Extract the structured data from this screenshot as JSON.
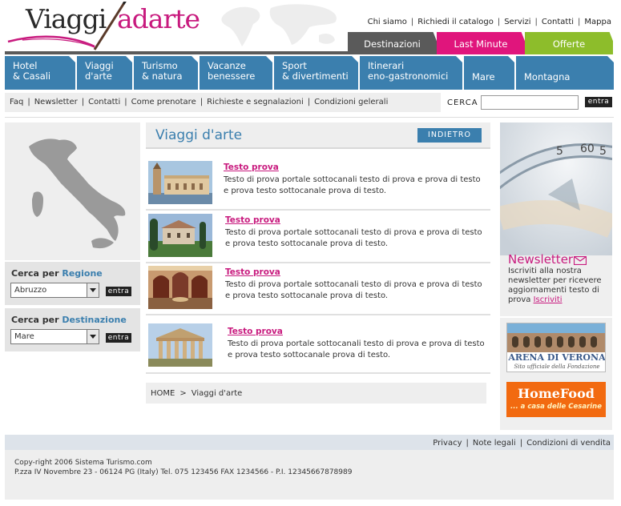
{
  "logo": {
    "part1": "Viaggi",
    "part2": "adarte"
  },
  "top_links": [
    "Chi siamo",
    "Richiedi il catalogo",
    "Servizi",
    "Contatti",
    "Mappa"
  ],
  "quick_tabs": [
    "Destinazioni",
    "Last Minute",
    "Offerte"
  ],
  "main_nav": [
    {
      "label": "Hotel\n& Casali"
    },
    {
      "label": "Viaggi\nd'arte"
    },
    {
      "label": "Turismo\n& natura"
    },
    {
      "label": "Vacanze\nbenessere"
    },
    {
      "label": "Sport\n& divertimenti"
    },
    {
      "label": "Itinerari\neno-gastronomici"
    },
    {
      "label": "Mare"
    },
    {
      "label": "Montagna"
    }
  ],
  "sub_links": [
    "Faq",
    "Newsletter",
    "Contatti",
    "Come prenotare",
    "Richieste e segnalazioni",
    "Condizioni gelerali"
  ],
  "search": {
    "label": "CERCA",
    "value": "",
    "button": "entra"
  },
  "left": {
    "regione": {
      "prefix": "Cerca per",
      "highlight": "Regione",
      "selected": "Abruzzo",
      "button": "entra"
    },
    "destinazione": {
      "prefix": "Cerca per",
      "highlight": "Destinazione",
      "selected": "Mare",
      "button": "entra"
    }
  },
  "section": {
    "title": "Viaggi d'arte",
    "back_button": "INDIETRO"
  },
  "articles": [
    {
      "title": "Testo prova",
      "text": "Testo di prova portale sottocanali testo di prova e prova di testo e prova testo sottocanale prova di testo."
    },
    {
      "title": "Testo prova",
      "text": "Testo di prova portale sottocanali testo di prova e prova di testo e prova testo sottocanale prova di testo."
    },
    {
      "title": "Testo prova",
      "text": "Testo di prova portale sottocanali testo di prova e prova di testo e prova testo sottocanale prova di testo."
    },
    {
      "title": "Testo prova",
      "text": "Testo di prova portale sottocanali testo di prova e prova di testo e prova testo sottocanale prova di testo."
    }
  ],
  "breadcrumb": {
    "home": "HOME",
    "sep": ">",
    "current": "Viaggi d'arte"
  },
  "newsletter": {
    "title": "Newsletter",
    "text": "Iscriviti alla nostra newsletter per ricevere aggiornamenti testo di prova",
    "link": "Iscriviti",
    "icon": "envelope-icon"
  },
  "banners": {
    "arena": {
      "title": "ARENA DI VERONA",
      "subtitle": "Sito ufficiale della Fondazione"
    },
    "homefood": {
      "title": "HomeFood",
      "subtitle": "... a casa delle Cesarine"
    }
  },
  "footer": {
    "links": [
      "Privacy",
      "Note legali",
      "Condizioni di vendita"
    ],
    "copyright": "Copy-right 2006 Sistema Turismo.com",
    "address": "P.zza IV Novembre 23 - 06124 PG (Italy) Tel. 075 123456 FAX 1234566 - P.I. 12345667878989"
  },
  "colors": {
    "brand_blue": "#3b7fae",
    "brand_pink": "#c81a7e",
    "last_minute": "#e0157c",
    "offerte": "#8dbd2b",
    "dark_gray": "#5a5a5a"
  }
}
